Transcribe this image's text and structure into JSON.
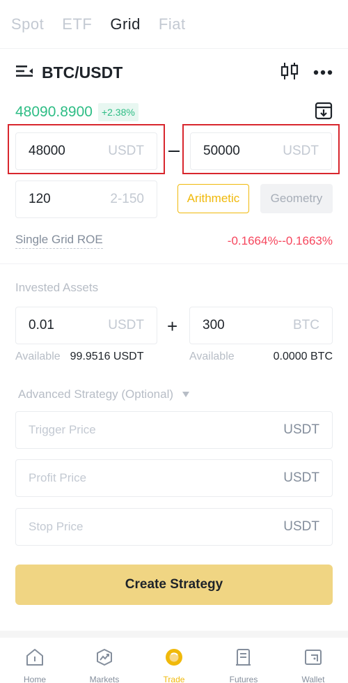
{
  "tabs": [
    "Spot",
    "ETF",
    "Grid",
    "Fiat"
  ],
  "active_tab": "Grid",
  "pair": {
    "name": "BTC/USDT"
  },
  "price": {
    "value": "48090.8900",
    "change": "+2.38%"
  },
  "range": {
    "lower": {
      "value": "48000",
      "unit": "USDT"
    },
    "upper": {
      "value": "50000",
      "unit": "USDT"
    }
  },
  "grids": {
    "value": "120",
    "hint": "2-150"
  },
  "modes": {
    "arithmetic": "Arithmetic",
    "geometry": "Geometry",
    "selected": "Arithmetic"
  },
  "roe": {
    "label": "Single Grid ROE",
    "value": "-0.1664%--0.1663%"
  },
  "invested": {
    "label": "Invested Assets",
    "quote": {
      "value": "0.01",
      "unit": "USDT"
    },
    "base": {
      "value": "300",
      "unit": "BTC"
    },
    "plus": "+",
    "available_label": "Available",
    "quote_available": "99.9516 USDT",
    "base_available": "0.0000 BTC"
  },
  "advanced": {
    "label": "Advanced Strategy (Optional)",
    "trigger": {
      "placeholder": "Trigger Price",
      "unit": "USDT"
    },
    "profit": {
      "placeholder": "Profit Price",
      "unit": "USDT"
    },
    "stop": {
      "placeholder": "Stop Price",
      "unit": "USDT"
    }
  },
  "create_button": "Create Strategy",
  "nav": [
    {
      "label": "Home",
      "icon": "home-icon"
    },
    {
      "label": "Markets",
      "icon": "markets-icon"
    },
    {
      "label": "Trade",
      "icon": "trade-icon"
    },
    {
      "label": "Futures",
      "icon": "futures-icon"
    },
    {
      "label": "Wallet",
      "icon": "wallet-icon"
    }
  ],
  "active_nav": "Trade",
  "colors": {
    "accent": "#f0b90b",
    "up": "#2ebd85",
    "down": "#f6465d",
    "highlight_box": "#d8262d"
  }
}
